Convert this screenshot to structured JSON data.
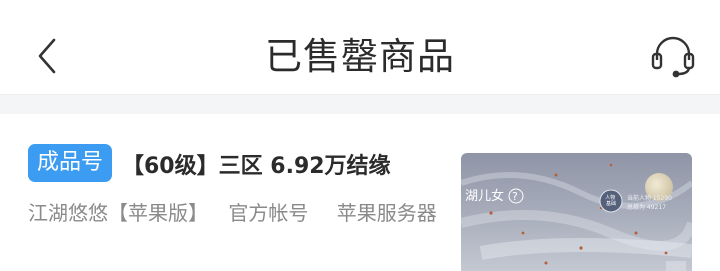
{
  "header": {
    "title": "已售罄商品",
    "back_icon": "chevron-left-icon",
    "support_icon": "headset-icon"
  },
  "listing": {
    "badge": "成品号",
    "title": "【60级】三区 6.92万结缘",
    "tags": [
      "江湖悠悠【苹果版】",
      "官方帐号",
      "苹果服务器"
    ],
    "thumbnail": {
      "caption": "湖儿女",
      "caption_symbol": "?",
      "emblem": "人物\n基础",
      "stat_lines": [
        "当前人物 15290",
        "总修为 49217"
      ]
    }
  },
  "colors": {
    "badge_bg": "#3c9cf2",
    "tag_text": "#8a8a8a",
    "title_text": "#2b2b2b",
    "divider_bg": "#f4f5f7"
  }
}
